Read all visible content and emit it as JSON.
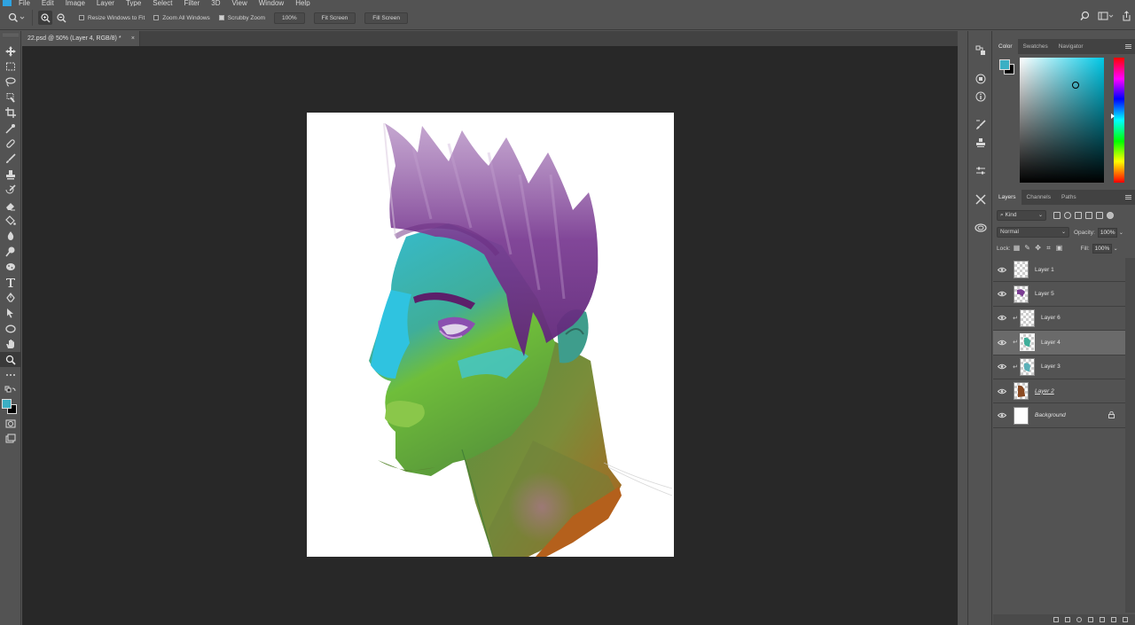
{
  "menu": {
    "items": [
      "File",
      "Edit",
      "Image",
      "Layer",
      "Type",
      "Select",
      "Filter",
      "3D",
      "View",
      "Window",
      "Help"
    ]
  },
  "options": {
    "resize_windows": "Resize Windows to Fit",
    "zoom_all": "Zoom All Windows",
    "scrubby": "Scrubby Zoom",
    "zoom_value": "100%",
    "fit_screen": "Fit Screen",
    "fill_screen": "Fill Screen"
  },
  "document": {
    "tab_title": "22.psd @ 50% (Layer 4, RGB/8) *",
    "close": "×"
  },
  "color_panel": {
    "tabs": [
      "Color",
      "Swatches",
      "Navigator"
    ],
    "foreground": "#3bafc4",
    "background": "#000000"
  },
  "layers_panel": {
    "tabs": [
      "Layers",
      "Channels",
      "Paths"
    ],
    "kind_label": "Kind",
    "blend_mode": "Normal",
    "opacity_label": "Opacity:",
    "opacity_value": "100%",
    "lock_label": "Lock:",
    "fill_label": "Fill:",
    "fill_value": "100%",
    "layers": [
      {
        "name": "Layer 1"
      },
      {
        "name": "Layer 5"
      },
      {
        "name": "Layer 6"
      },
      {
        "name": "Layer 4"
      },
      {
        "name": "Layer 3"
      },
      {
        "name": "Layer 2"
      },
      {
        "name": "Background"
      }
    ]
  }
}
